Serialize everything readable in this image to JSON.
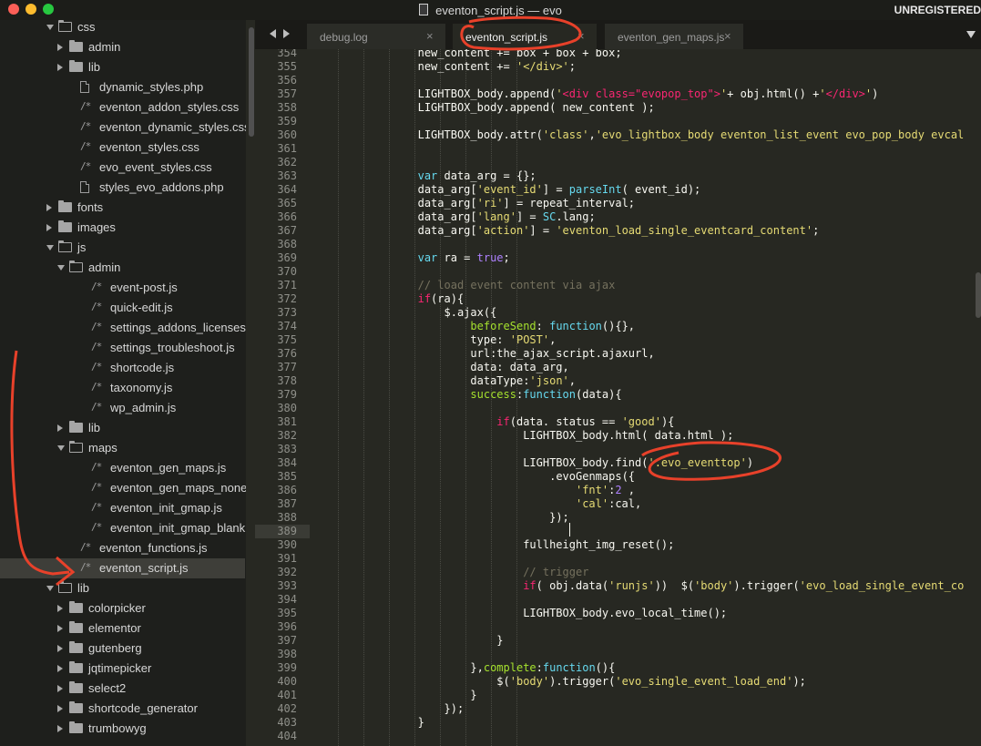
{
  "window": {
    "title": "eventon_script.js — evo",
    "license_status": "UNREGISTERED"
  },
  "sidebar": {
    "rows": [
      {
        "label": "css",
        "kind": "folder-open",
        "depth": 0
      },
      {
        "label": "admin",
        "kind": "folder",
        "depth": 1
      },
      {
        "label": "lib",
        "kind": "folder",
        "depth": 1
      },
      {
        "label": "dynamic_styles.php",
        "kind": "file",
        "depth": 1
      },
      {
        "label": "eventon_addon_styles.css",
        "kind": "code",
        "depth": 1
      },
      {
        "label": "eventon_dynamic_styles.css",
        "kind": "code",
        "depth": 1
      },
      {
        "label": "eventon_styles.css",
        "kind": "code",
        "depth": 1
      },
      {
        "label": "evo_event_styles.css",
        "kind": "code",
        "depth": 1
      },
      {
        "label": "styles_evo_addons.php",
        "kind": "file",
        "depth": 1
      },
      {
        "label": "fonts",
        "kind": "folder",
        "depth": 0
      },
      {
        "label": "images",
        "kind": "folder",
        "depth": 0
      },
      {
        "label": "js",
        "kind": "folder-open",
        "depth": 0
      },
      {
        "label": "admin",
        "kind": "folder-open",
        "depth": 1
      },
      {
        "label": "event-post.js",
        "kind": "code",
        "depth": 2
      },
      {
        "label": "quick-edit.js",
        "kind": "code",
        "depth": 2
      },
      {
        "label": "settings_addons_licenses.js",
        "kind": "code",
        "depth": 2
      },
      {
        "label": "settings_troubleshoot.js",
        "kind": "code",
        "depth": 2
      },
      {
        "label": "shortcode.js",
        "kind": "code",
        "depth": 2
      },
      {
        "label": "taxonomy.js",
        "kind": "code",
        "depth": 2
      },
      {
        "label": "wp_admin.js",
        "kind": "code",
        "depth": 2
      },
      {
        "label": "lib",
        "kind": "folder",
        "depth": 1
      },
      {
        "label": "maps",
        "kind": "folder-open",
        "depth": 1
      },
      {
        "label": "eventon_gen_maps.js",
        "kind": "code",
        "depth": 2
      },
      {
        "label": "eventon_gen_maps_none.js",
        "kind": "code",
        "depth": 2
      },
      {
        "label": "eventon_init_gmap.js",
        "kind": "code",
        "depth": 2
      },
      {
        "label": "eventon_init_gmap_blank.js",
        "kind": "code",
        "depth": 2
      },
      {
        "label": "eventon_functions.js",
        "kind": "code",
        "depth": 1
      },
      {
        "label": "eventon_script.js",
        "kind": "code",
        "depth": 1,
        "selected": true
      },
      {
        "label": "lib",
        "kind": "folder-open",
        "depth": 0
      },
      {
        "label": "colorpicker",
        "kind": "folder",
        "depth": 1
      },
      {
        "label": "elementor",
        "kind": "folder",
        "depth": 1
      },
      {
        "label": "gutenberg",
        "kind": "folder",
        "depth": 1
      },
      {
        "label": "jqtimepicker",
        "kind": "folder",
        "depth": 1
      },
      {
        "label": "select2",
        "kind": "folder",
        "depth": 1
      },
      {
        "label": "shortcode_generator",
        "kind": "folder",
        "depth": 1
      },
      {
        "label": "trumbowyg",
        "kind": "folder",
        "depth": 1
      }
    ]
  },
  "tabs": [
    {
      "label": "debug.log",
      "active": false
    },
    {
      "label": "eventon_script.js",
      "active": true
    },
    {
      "label": "eventon_gen_maps.js",
      "active": false
    }
  ],
  "editor": {
    "current_line": 389,
    "lines": [
      {
        "n": 354,
        "indent": 16,
        "tokens": [
          [
            "pl",
            "new_content += box + box + box;"
          ]
        ]
      },
      {
        "n": 355,
        "indent": 16,
        "tokens": [
          [
            "pl",
            "new_content += "
          ],
          [
            "st",
            "'</div>'"
          ],
          [
            "pl",
            ";"
          ]
        ]
      },
      {
        "n": 356,
        "indent": 0,
        "tokens": []
      },
      {
        "n": 357,
        "indent": 16,
        "tokens": [
          [
            "pl",
            "LIGHTBOX_body.append("
          ],
          [
            "st",
            "'"
          ],
          [
            "kw",
            "<div class=\"evopop_top\">"
          ],
          [
            "st",
            "'"
          ],
          [
            "pl",
            "+ obj.html() +"
          ],
          [
            "st",
            "'"
          ],
          [
            "kw",
            "</div>"
          ],
          [
            "st",
            "'"
          ],
          [
            "pl",
            ")"
          ]
        ]
      },
      {
        "n": 358,
        "indent": 16,
        "tokens": [
          [
            "pl",
            "LIGHTBOX_body.append( new_content );"
          ]
        ]
      },
      {
        "n": 359,
        "indent": 0,
        "tokens": []
      },
      {
        "n": 360,
        "indent": 16,
        "tokens": [
          [
            "pl",
            "LIGHTBOX_body.attr("
          ],
          [
            "st",
            "'class'"
          ],
          [
            "pl",
            ","
          ],
          [
            "st",
            "'evo_lightbox_body eventon_list_event evo_pop_body evcal"
          ]
        ]
      },
      {
        "n": 361,
        "indent": 0,
        "tokens": []
      },
      {
        "n": 362,
        "indent": 0,
        "tokens": []
      },
      {
        "n": 363,
        "indent": 16,
        "tokens": [
          [
            "bi",
            "var "
          ],
          [
            "pl",
            "data_arg = {};"
          ]
        ]
      },
      {
        "n": 364,
        "indent": 16,
        "tokens": [
          [
            "pl",
            "data_arg["
          ],
          [
            "st",
            "'event_id'"
          ],
          [
            "pl",
            "] = "
          ],
          [
            "bi",
            "parseInt"
          ],
          [
            "pl",
            "( event_id);"
          ]
        ]
      },
      {
        "n": 365,
        "indent": 16,
        "tokens": [
          [
            "pl",
            "data_arg["
          ],
          [
            "st",
            "'ri'"
          ],
          [
            "pl",
            "] = repeat_interval;"
          ]
        ]
      },
      {
        "n": 366,
        "indent": 16,
        "tokens": [
          [
            "pl",
            "data_arg["
          ],
          [
            "st",
            "'lang'"
          ],
          [
            "pl",
            "] = "
          ],
          [
            "bi",
            "SC"
          ],
          [
            "pl",
            ".lang;"
          ]
        ]
      },
      {
        "n": 367,
        "indent": 16,
        "tokens": [
          [
            "pl",
            "data_arg["
          ],
          [
            "st",
            "'action'"
          ],
          [
            "pl",
            "] = "
          ],
          [
            "st",
            "'eventon_load_single_eventcard_content'"
          ],
          [
            "pl",
            ";"
          ]
        ]
      },
      {
        "n": 368,
        "indent": 0,
        "tokens": []
      },
      {
        "n": 369,
        "indent": 16,
        "tokens": [
          [
            "bi",
            "var "
          ],
          [
            "pl",
            "ra = "
          ],
          [
            "nu",
            "true"
          ],
          [
            "pl",
            ";"
          ]
        ]
      },
      {
        "n": 370,
        "indent": 0,
        "tokens": []
      },
      {
        "n": 371,
        "indent": 16,
        "tokens": [
          [
            "cm",
            "// load event content via ajax"
          ]
        ]
      },
      {
        "n": 372,
        "indent": 16,
        "tokens": [
          [
            "kw",
            "if"
          ],
          [
            "pl",
            "(ra){"
          ]
        ]
      },
      {
        "n": 373,
        "indent": 20,
        "tokens": [
          [
            "pl",
            "$.ajax({"
          ]
        ]
      },
      {
        "n": 374,
        "indent": 24,
        "tokens": [
          [
            "fn",
            "beforeSend"
          ],
          [
            "pl",
            ": "
          ],
          [
            "bi",
            "function"
          ],
          [
            "pl",
            "(){},"
          ]
        ]
      },
      {
        "n": 375,
        "indent": 24,
        "tokens": [
          [
            "pl",
            "type: "
          ],
          [
            "st",
            "'POST'"
          ],
          [
            "pl",
            ","
          ]
        ]
      },
      {
        "n": 376,
        "indent": 24,
        "tokens": [
          [
            "pl",
            "url:the_ajax_script.ajaxurl,"
          ]
        ]
      },
      {
        "n": 377,
        "indent": 24,
        "tokens": [
          [
            "pl",
            "data: data_arg,"
          ]
        ]
      },
      {
        "n": 378,
        "indent": 24,
        "tokens": [
          [
            "pl",
            "dataType:"
          ],
          [
            "st",
            "'json'"
          ],
          [
            "pl",
            ","
          ]
        ]
      },
      {
        "n": 379,
        "indent": 24,
        "tokens": [
          [
            "fn",
            "success"
          ],
          [
            "pl",
            ":"
          ],
          [
            "bi",
            "function"
          ],
          [
            "pl",
            "(data){"
          ]
        ]
      },
      {
        "n": 380,
        "indent": 0,
        "tokens": []
      },
      {
        "n": 381,
        "indent": 28,
        "tokens": [
          [
            "kw",
            "if"
          ],
          [
            "pl",
            "(data. status == "
          ],
          [
            "st",
            "'good'"
          ],
          [
            "pl",
            "){"
          ]
        ]
      },
      {
        "n": 382,
        "indent": 32,
        "tokens": [
          [
            "pl",
            "LIGHTBOX_body.html( data.html );"
          ]
        ]
      },
      {
        "n": 383,
        "indent": 0,
        "tokens": []
      },
      {
        "n": 384,
        "indent": 32,
        "tokens": [
          [
            "pl",
            "LIGHTBOX_body.find("
          ],
          [
            "st",
            "'.evo_eventtop'"
          ],
          [
            "pl",
            ")"
          ]
        ]
      },
      {
        "n": 385,
        "indent": 36,
        "tokens": [
          [
            "pl",
            ".evoGenmaps({"
          ]
        ]
      },
      {
        "n": 386,
        "indent": 40,
        "tokens": [
          [
            "st",
            "'fnt'"
          ],
          [
            "pl",
            ":"
          ],
          [
            "nu",
            "2"
          ],
          [
            "pl",
            " ,"
          ]
        ]
      },
      {
        "n": 387,
        "indent": 40,
        "tokens": [
          [
            "st",
            "'cal'"
          ],
          [
            "pl",
            ":cal,"
          ]
        ]
      },
      {
        "n": 388,
        "indent": 36,
        "tokens": [
          [
            "pl",
            "});"
          ]
        ]
      },
      {
        "n": 389,
        "indent": 0,
        "tokens": []
      },
      {
        "n": 390,
        "indent": 32,
        "tokens": [
          [
            "pl",
            "fullheight_img_reset();"
          ]
        ]
      },
      {
        "n": 391,
        "indent": 0,
        "tokens": []
      },
      {
        "n": 392,
        "indent": 32,
        "tokens": [
          [
            "cm",
            "// trigger"
          ]
        ]
      },
      {
        "n": 393,
        "indent": 32,
        "tokens": [
          [
            "kw",
            "if"
          ],
          [
            "pl",
            "( obj.data("
          ],
          [
            "st",
            "'runjs'"
          ],
          [
            "pl",
            "))  $("
          ],
          [
            "st",
            "'body'"
          ],
          [
            "pl",
            ").trigger("
          ],
          [
            "st",
            "'evo_load_single_event_co"
          ]
        ]
      },
      {
        "n": 394,
        "indent": 0,
        "tokens": []
      },
      {
        "n": 395,
        "indent": 32,
        "tokens": [
          [
            "pl",
            "LIGHTBOX_body.evo_local_time();"
          ]
        ]
      },
      {
        "n": 396,
        "indent": 0,
        "tokens": []
      },
      {
        "n": 397,
        "indent": 28,
        "tokens": [
          [
            "pl",
            "}"
          ]
        ]
      },
      {
        "n": 398,
        "indent": 0,
        "tokens": []
      },
      {
        "n": 399,
        "indent": 24,
        "tokens": [
          [
            "pl",
            "},"
          ],
          [
            "fn",
            "complete"
          ],
          [
            "pl",
            ":"
          ],
          [
            "bi",
            "function"
          ],
          [
            "pl",
            "(){"
          ]
        ]
      },
      {
        "n": 400,
        "indent": 28,
        "tokens": [
          [
            "pl",
            "$("
          ],
          [
            "st",
            "'body'"
          ],
          [
            "pl",
            ").trigger("
          ],
          [
            "st",
            "'evo_single_event_load_end'"
          ],
          [
            "pl",
            ");"
          ]
        ]
      },
      {
        "n": 401,
        "indent": 24,
        "tokens": [
          [
            "pl",
            "}"
          ]
        ]
      },
      {
        "n": 402,
        "indent": 20,
        "tokens": [
          [
            "pl",
            "});"
          ]
        ]
      },
      {
        "n": 403,
        "indent": 16,
        "tokens": [
          [
            "pl",
            "}"
          ]
        ]
      },
      {
        "n": 404,
        "indent": 0,
        "tokens": []
      }
    ]
  },
  "annotation_color": "#e8412a"
}
